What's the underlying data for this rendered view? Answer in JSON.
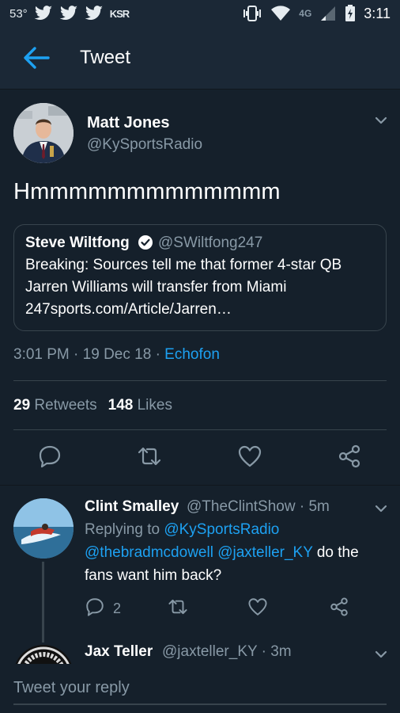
{
  "status_bar": {
    "temperature": "53°",
    "app_badge": "KSR",
    "network": "4G",
    "time": "3:11"
  },
  "app_bar": {
    "title": "Tweet"
  },
  "tweet": {
    "author_name": "Matt Jones",
    "author_handle": "@KySportsRadio",
    "text": "Hmmmmmmmmmmmmm",
    "quoted": {
      "name": "Steve Wiltfong",
      "handle": "@SWiltfong247",
      "line1": "Breaking: Sources tell me that former 4-star QB",
      "line2": "Jarren Williams will transfer from Miami",
      "line3": "247sports.com/Article/Jarren…"
    },
    "time": "3:01 PM",
    "date": "19 Dec 18",
    "source": "Echofon",
    "retweets_count": "29",
    "retweets_label": "Retweets",
    "likes_count": "148",
    "likes_label": "Likes"
  },
  "replies": [
    {
      "name": "Clint Smalley",
      "handle": "@TheClintShow",
      "age": "5m",
      "replying_to_prefix": "Replying to",
      "mention1": "@KySportsRadio",
      "mention2": "@thebradmcdowell",
      "mention3": "@jaxteller_KY",
      "text_part1": "do the",
      "text_part2": "fans want him back?",
      "reply_count": "2"
    },
    {
      "name": "Jax Teller",
      "handle": "@jaxteller_KY",
      "age": "3m"
    }
  ],
  "composer": {
    "placeholder": "Tweet your reply"
  },
  "colors": {
    "background": "#15202b",
    "accent": "#1da1f2",
    "muted": "#8899a6"
  }
}
